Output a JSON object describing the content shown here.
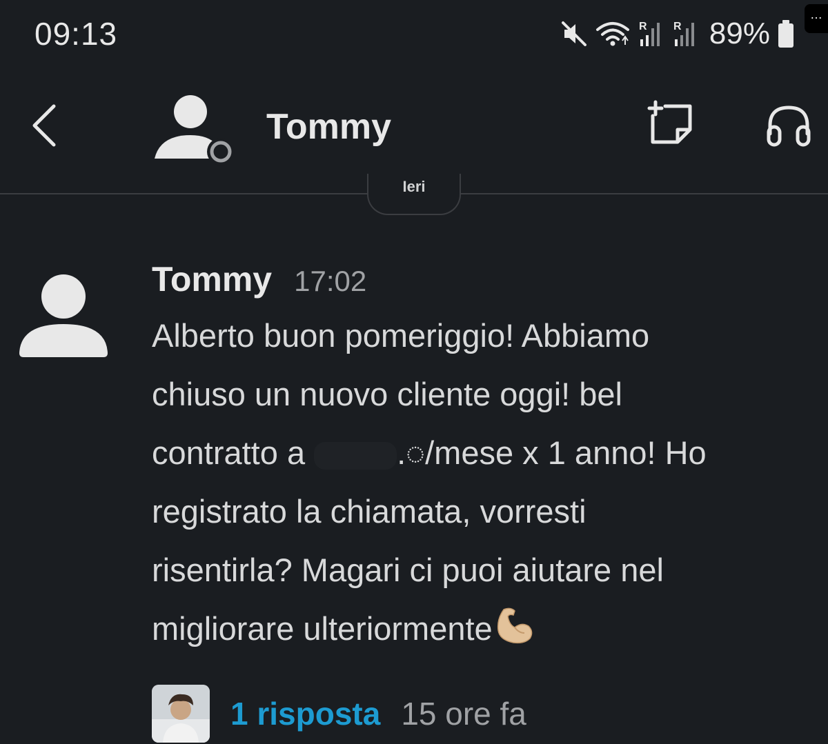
{
  "status_bar": {
    "time": "09:13",
    "battery_percent": "89%",
    "icons": [
      "mute-icon",
      "wifi-icon",
      "signal-r-icon",
      "signal-r-icon",
      "battery-icon"
    ],
    "corner_menu": "…"
  },
  "header": {
    "title": "Tommy",
    "presence": "away",
    "icons": {
      "back": "chevron-left-icon",
      "new_canvas": "new-canvas-icon",
      "huddle": "headphones-icon"
    }
  },
  "date_divider": {
    "label": "Ieri"
  },
  "message": {
    "author": "Tommy",
    "time": "17:02",
    "lines": [
      [
        "Alberto buon pomeriggio! Abbiamo"
      ],
      [
        "chiuso un nuovo cliente oggi! bel"
      ],
      [
        "contratto a ",
        ".◌/mese x 1 anno! Ho"
      ],
      [
        "registrato la chiamata, vorresti"
      ],
      [
        "risentirla? Magari ci puoi aiutare nel"
      ],
      [
        "migliorare ulteriormente"
      ]
    ],
    "emoji": "flexed-biceps"
  },
  "thread": {
    "reply_count": "1 risposta",
    "last_reply": "15 ore fa"
  },
  "colors": {
    "background": "#1a1d21",
    "link": "#1d9bd1",
    "divider": "#3b3d41"
  }
}
